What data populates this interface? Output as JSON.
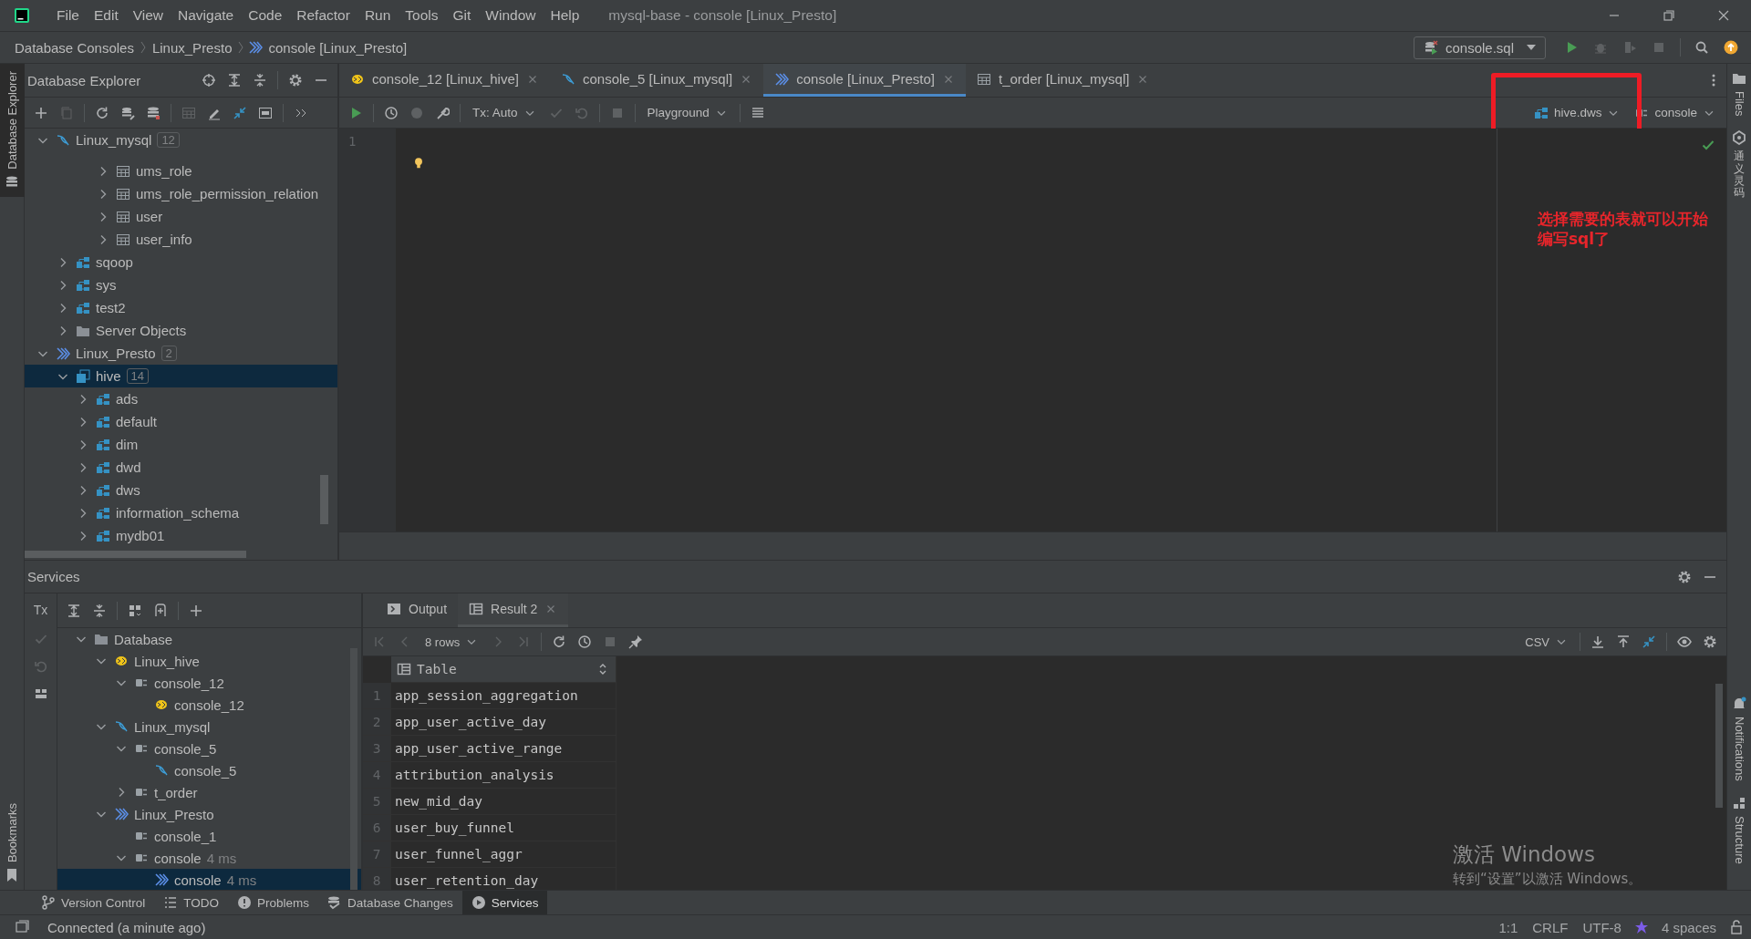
{
  "window": {
    "title": "mysql-base - console [Linux_Presto]",
    "menu": [
      "File",
      "Edit",
      "View",
      "Navigate",
      "Code",
      "Refactor",
      "Run",
      "Tools",
      "Git",
      "Window",
      "Help"
    ]
  },
  "breadcrumb": [
    "Database Consoles",
    "Linux_Presto",
    "console [Linux_Presto]"
  ],
  "run_config": "console.sql",
  "left_strip": {
    "top": "Database Explorer",
    "bottom": "Bookmarks"
  },
  "right_strip": {
    "top": [
      {
        "label": "Files",
        "kind": "latin"
      },
      {
        "label": "通义灵码",
        "kind": "cjk"
      }
    ],
    "bottom": [
      {
        "label": "Notifications",
        "kind": "latin"
      },
      {
        "label": "Structure",
        "kind": "latin"
      }
    ]
  },
  "explorer": {
    "title": "Database Explorer",
    "tree": [
      {
        "label": "Linux_mysql",
        "count": "12",
        "kind": "mysql",
        "expanded": true,
        "selected": false,
        "children": [
          {
            "kind": "scrolled",
            "children": [
              {
                "kind": "scrolled",
                "children": [
                  {
                    "label": "ums_role",
                    "kind": "table",
                    "expanded": false,
                    "selected": false
                  },
                  {
                    "label": "ums_role_permission_relation",
                    "kind": "table",
                    "expanded": false,
                    "selected": false
                  },
                  {
                    "label": "user",
                    "kind": "table",
                    "expanded": false,
                    "selected": false
                  },
                  {
                    "label": "user_info",
                    "kind": "table",
                    "expanded": false,
                    "selected": false
                  }
                ]
              }
            ]
          },
          {
            "label": "sqoop",
            "kind": "schema",
            "expanded": false,
            "selected": false
          },
          {
            "label": "sys",
            "kind": "schema",
            "expanded": false,
            "selected": false
          },
          {
            "label": "test2",
            "kind": "schema",
            "expanded": false,
            "selected": false
          },
          {
            "label": "Server Objects",
            "kind": "folder",
            "expanded": false,
            "selected": false
          }
        ]
      },
      {
        "label": "Linux_Presto",
        "count": "2",
        "kind": "presto",
        "expanded": true,
        "selected": false,
        "children": [
          {
            "label": "hive",
            "count": "14",
            "kind": "catalog",
            "expanded": true,
            "selected": true,
            "children": [
              {
                "label": "ads",
                "kind": "schema",
                "expanded": false,
                "selected": false
              },
              {
                "label": "default",
                "kind": "schema",
                "expanded": false,
                "selected": false
              },
              {
                "label": "dim",
                "kind": "schema",
                "expanded": false,
                "selected": false
              },
              {
                "label": "dwd",
                "kind": "schema",
                "expanded": false,
                "selected": false
              },
              {
                "label": "dws",
                "kind": "schema",
                "expanded": false,
                "selected": false
              },
              {
                "label": "information_schema",
                "kind": "schema",
                "expanded": false,
                "selected": false
              },
              {
                "label": "mydb01",
                "kind": "schema",
                "expanded": false,
                "selected": false
              }
            ]
          }
        ]
      }
    ]
  },
  "editor": {
    "tabs": [
      {
        "label": "console_12 [Linux_hive]",
        "kind": "hive",
        "selected": false
      },
      {
        "label": "console_5 [Linux_mysql]",
        "kind": "mysql",
        "selected": false
      },
      {
        "label": "console [Linux_Presto]",
        "kind": "presto",
        "selected": true
      },
      {
        "label": "t_order [Linux_mysql]",
        "kind": "table",
        "selected": false
      }
    ],
    "tx_mode": "Tx: Auto",
    "playground": "Playground",
    "schema": "hive.dws",
    "session": "console",
    "line_numbers": [
      "1"
    ],
    "annotation": "选择需要的表就可以开始编写sql了"
  },
  "services": {
    "title": "Services",
    "tx_label": "Tx",
    "tree": [
      {
        "label": "Database",
        "kind": "folder",
        "expanded": true,
        "selected": false,
        "children": [
          {
            "label": "Linux_hive",
            "kind": "hive",
            "expanded": true,
            "selected": false,
            "children": [
              {
                "label": "console_12",
                "kind": "console",
                "expanded": true,
                "selected": false,
                "children": [
                  {
                    "label": "console_12",
                    "kind": "hive",
                    "selected": false
                  }
                ]
              }
            ]
          },
          {
            "label": "Linux_mysql",
            "kind": "mysql",
            "expanded": true,
            "selected": false,
            "children": [
              {
                "label": "console_5",
                "kind": "console",
                "expanded": true,
                "selected": false,
                "children": [
                  {
                    "label": "console_5",
                    "kind": "mysql",
                    "selected": false
                  }
                ]
              },
              {
                "label": "t_order",
                "kind": "console",
                "expanded": false,
                "selected": false
              }
            ]
          },
          {
            "label": "Linux_Presto",
            "kind": "presto",
            "expanded": true,
            "selected": false,
            "children": [
              {
                "label": "console_1",
                "kind": "console",
                "selected": false
              },
              {
                "label": "console",
                "detail": "4 ms",
                "kind": "console",
                "expanded": true,
                "selected": false,
                "children": [
                  {
                    "label": "console",
                    "detail": "4 ms",
                    "kind": "presto",
                    "selected": true
                  }
                ]
              }
            ]
          }
        ]
      }
    ],
    "result_tabs": [
      {
        "label": "Output",
        "kind": "output",
        "selected": false
      },
      {
        "label": "Result 2",
        "kind": "table",
        "selected": true
      }
    ],
    "page_size": "8 rows",
    "export_format": "CSV",
    "table": {
      "columns": [
        "Table"
      ],
      "rows": [
        {
          "number": "1",
          "cells": [
            "app_session_aggregation"
          ]
        },
        {
          "number": "2",
          "cells": [
            "app_user_active_day"
          ]
        },
        {
          "number": "3",
          "cells": [
            "app_user_active_range"
          ]
        },
        {
          "number": "4",
          "cells": [
            "attribution_analysis"
          ]
        },
        {
          "number": "5",
          "cells": [
            "new_mid_day"
          ]
        },
        {
          "number": "6",
          "cells": [
            "user_buy_funnel"
          ]
        },
        {
          "number": "7",
          "cells": [
            "user_funnel_aggr"
          ]
        },
        {
          "number": "8",
          "cells": [
            "user_retention_day"
          ]
        }
      ]
    }
  },
  "tool_tabs": [
    {
      "label": "Version Control",
      "kind": "branch",
      "selected": false
    },
    {
      "label": "TODO",
      "kind": "list",
      "selected": false
    },
    {
      "label": "Problems",
      "kind": "warn",
      "selected": false
    },
    {
      "label": "Database Changes",
      "kind": "dbchanges",
      "selected": false
    },
    {
      "label": "Services",
      "kind": "services",
      "selected": true
    }
  ],
  "status_bar": {
    "message": "Connected (a minute ago)",
    "position": "1:1",
    "line_ending": "CRLF",
    "encoding": "UTF-8",
    "indent": "4 spaces"
  },
  "os_overlay": {
    "title": "激活 Windows",
    "subtitle": "转到“设置”以激活 Windows。"
  }
}
